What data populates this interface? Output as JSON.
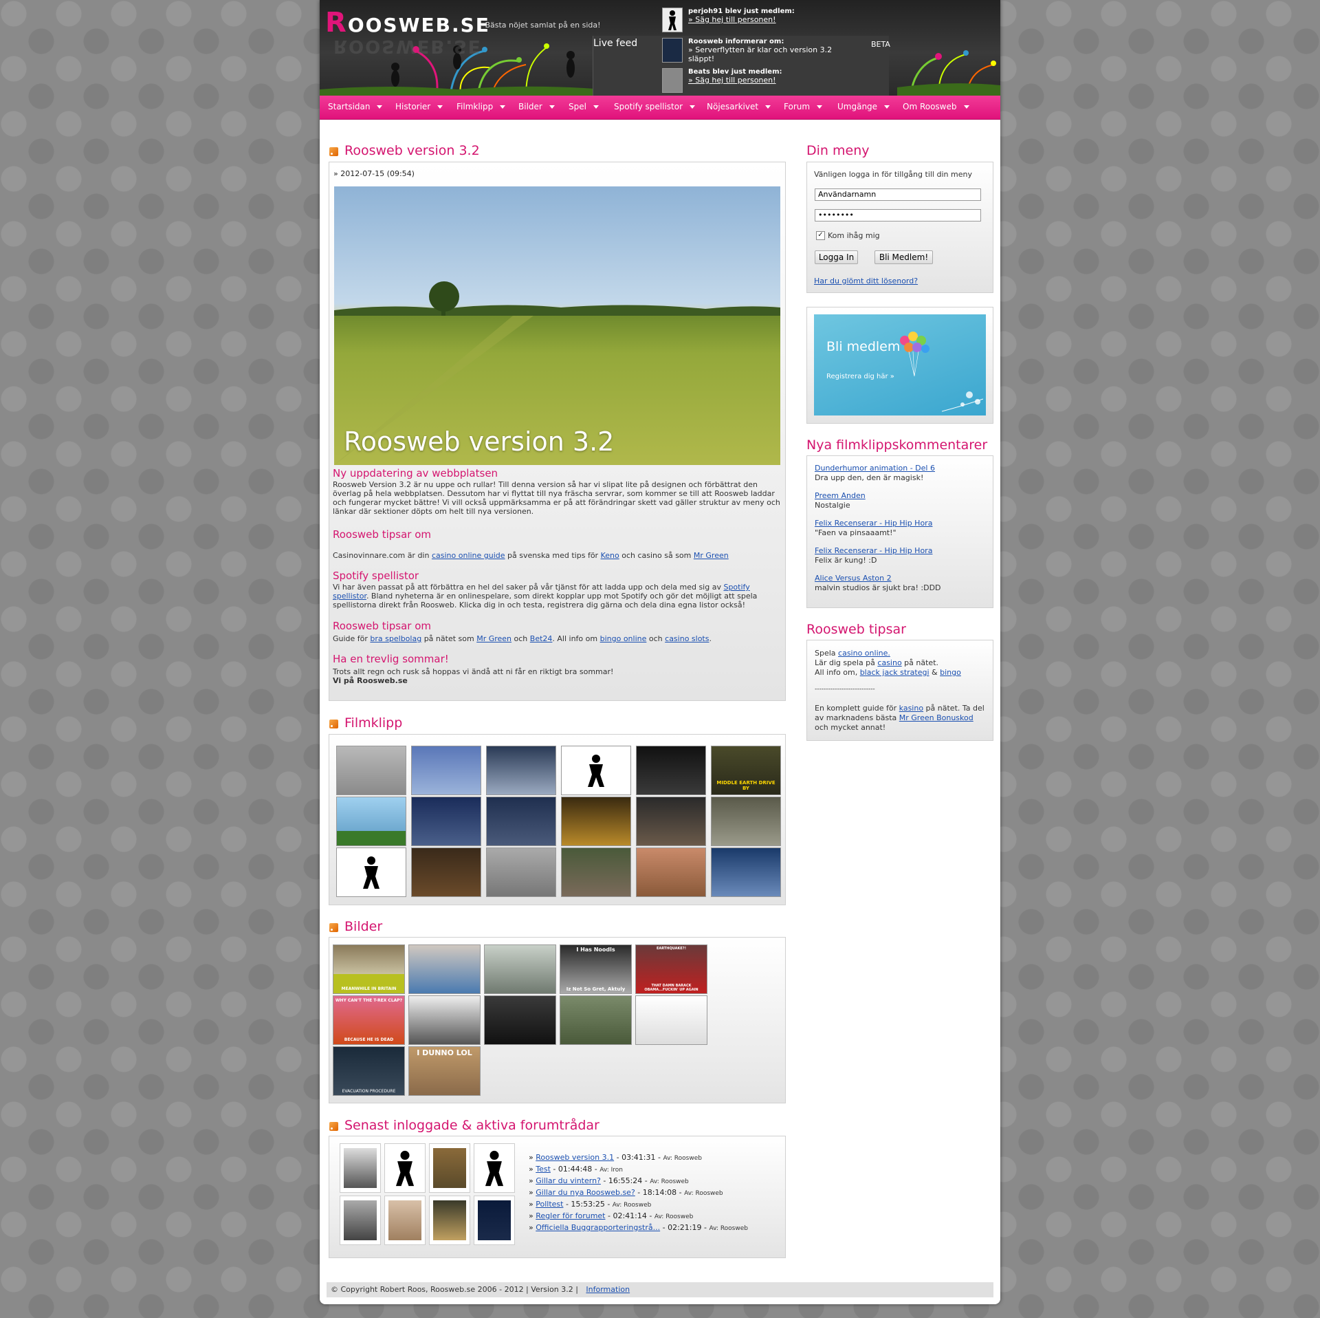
{
  "header": {
    "logo_text": "OOSWEB.SE",
    "logo_initial": "R",
    "tagline": "- Bästa nöjet samlat på en sida!",
    "live_feed_label": "Live feed",
    "beta_label": "BETA",
    "feed": [
      {
        "title": "perjoh91 blev just medlem:",
        "link": "» Säg hej till personen!"
      },
      {
        "title": "Roosweb informerar om:",
        "text": "» Serverflytten är klar och version 3.2 släppt!"
      },
      {
        "title": "Beats blev just medlem:",
        "link": "» Säg hej till personen!"
      }
    ]
  },
  "nav": [
    "Startsidan",
    "Historier",
    "Filmklipp",
    "Bilder",
    "Spel",
    "Spotify spellistor",
    "Nöjesarkivet",
    "Forum",
    "Umgänge",
    "Om Roosweb"
  ],
  "article": {
    "title": "Roosweb version 3.2",
    "date": "» 2012-07-15 (09:54)",
    "hero_text": "Roosweb version 3.2",
    "s1_h": "Ny uppdatering av webbplatsen",
    "s1_p": "Roosweb Version 3.2 är nu uppe och rullar! Till denna version så har vi slipat lite på designen och förbättrat den överlag på hela webbplatsen. Dessutom har vi flyttat till nya fräscha servrar, som kommer se till att Roosweb laddar och fungerar mycket bättre! Vi vill också uppmärksamma er på att förändringar skett vad gäller struktur av meny och länkar där sektioner döpts om helt till nya versionen.",
    "s2_h": "Roosweb tipsar om",
    "s2_a": "Casinovinnare.com är din ",
    "s2_l1": "casino online guide",
    "s2_b": " på svenska med tips för ",
    "s2_l2": "Keno",
    "s2_c": " och casino så som ",
    "s2_l3": "Mr Green",
    "s3_h": "Spotify spellistor",
    "s3_a": "Vi har även passat på att förbättra en hel del saker på vår tjänst för att ladda upp och dela med sig av ",
    "s3_l": "Spotify spellistor",
    "s3_b": ". Bland nyheterna är en onlinespelare, som direkt kopplar upp mot Spotify och gör det möjligt att spela spellistorna direkt från Roosweb. Klicka dig in och testa, registrera dig gärna och dela dina egna listor också!",
    "s4_h": "Roosweb tipsar om",
    "s4_a": "Guide för ",
    "s4_l1": "bra spelbolag",
    "s4_b": " på nätet som ",
    "s4_l2": "Mr Green",
    "s4_c": " och ",
    "s4_l3": "Bet24",
    "s4_d": ". All info om ",
    "s4_l4": "bingo online",
    "s4_e": " och ",
    "s4_l5": "casino slots",
    "s4_f": ".",
    "s5_h": "Ha en trevlig sommar!",
    "s5_p": "Trots allt regn och rusk så hoppas vi ändå att ni får en riktigt bra sommar!",
    "s5_sig": "Vi på Roosweb.se"
  },
  "filmklipp": {
    "title": "Filmklipp",
    "thumb_caption": "MIDDLE EARTH DRIVE BY"
  },
  "bilder": {
    "title": "Bilder",
    "captions": [
      "MEANWHILE IN BRITAIN",
      "I Has Noodls",
      "Iz Not So Gret, Aktuly",
      "WHY CAN'T THE T-REX CLAP?",
      "BECAUSE HE IS DEAD",
      "I DUNNO LOL",
      "EVACUATION PROCEDURE",
      "EARTHQUAKE?!",
      "THAT DAMN BARACK OBAMA...FUCKIN' UP AGAIN"
    ]
  },
  "forum": {
    "title": "Senast inloggade & aktiva forumtrådar",
    "threads": [
      {
        "title": "Roosweb version 3.1",
        "time": " - 03:41:31",
        "by": "Av: Roosweb"
      },
      {
        "title": "Test",
        "time": " - 01:44:48",
        "by": "Av: Iron"
      },
      {
        "title": "Gillar du vintern?",
        "time": " - 16:55:24",
        "by": "Av: Roosweb"
      },
      {
        "title": "Gillar du nya Roosweb.se?",
        "time": " - 18:14:08",
        "by": "Av: Roosweb"
      },
      {
        "title": "Polltest",
        "time": " - 15:53:25",
        "by": "Av: Roosweb"
      },
      {
        "title": "Regler för forumet",
        "time": " - 02:41:14",
        "by": "Av: Roosweb"
      },
      {
        "title": "Officiella Buggrapporteringstrå...",
        "time": " - 02:21:19",
        "by": "Av: Roosweb"
      }
    ]
  },
  "sidebar": {
    "menu_title": "Din meny",
    "login_prompt": "Vänligen logga in för tillgång till din meny",
    "username_value": "Användarnamn",
    "password_value": "••••••••",
    "remember_label": "Kom ihåg mig",
    "login_button": "Logga In",
    "register_button": "Bli Medlem!",
    "forgot_link": "Har du glömt ditt lösenord?",
    "banner_title": "Bli medlem",
    "banner_sub": "Registrera dig här »",
    "comments_title": "Nya filmklippskommentarer",
    "comments": [
      {
        "link": "Dunderhumor animation - Del 6",
        "text": "Dra upp den, den är magisk!"
      },
      {
        "link": "Preem Anden",
        "text": "Nostalgie"
      },
      {
        "link": "Felix Recenserar - Hip Hip Hora",
        "text": "\"Faen va pinsaaamt!\""
      },
      {
        "link": "Felix Recenserar - Hip Hip Hora",
        "text": "Felix är kung! :D"
      },
      {
        "link": "Alice Versus Aston 2",
        "text": "malvin studios är sjukt bra! :DDD"
      }
    ],
    "tips_title": "Roosweb tipsar",
    "tips_l1a": "Spela ",
    "tips_l1_link": "casino online.",
    "tips_l2a": "Lär dig spela på ",
    "tips_l2_link": "casino",
    "tips_l2b": " på nätet.",
    "tips_l3a": "All info om, ",
    "tips_l3_link1": "black jack strategi",
    "tips_l3b": " & ",
    "tips_l3_link2": "bingo",
    "tips_divider": "---------------------------",
    "tips_p2a": "En komplett guide för ",
    "tips_p2_link1": "kasino",
    "tips_p2b": " på nätet. Ta del av marknadens bästa ",
    "tips_p2_link2": "Mr Green Bonuskod",
    "tips_p2c": " och mycket annat!"
  },
  "footer": {
    "copyright": "© Copyright Robert Roos, Roosweb.se 2006 - 2012  | Version 3.2 |",
    "info_link": "Information"
  }
}
